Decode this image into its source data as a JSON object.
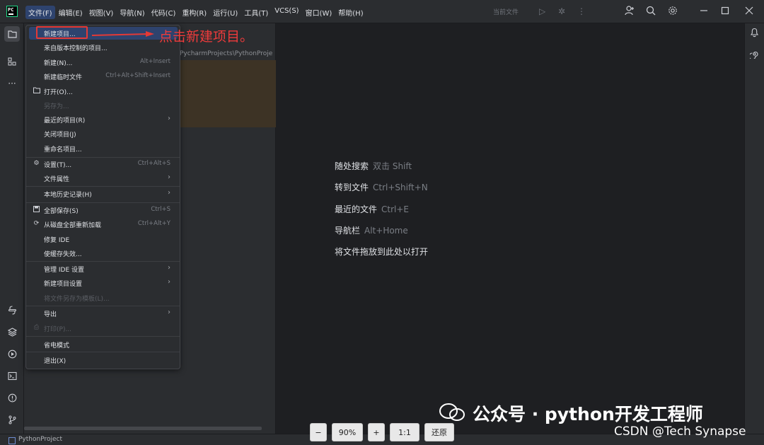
{
  "menubar": {
    "items": [
      "文件(F)",
      "编辑(E)",
      "视图(V)",
      "导航(N)",
      "代码(C)",
      "重构(R)",
      "运行(U)",
      "工具(T)",
      "VCS(S)",
      "窗口(W)",
      "帮助(H)"
    ],
    "current_file": "当前文件"
  },
  "project": {
    "path": "PycharmProjects\\PythonProje",
    "name": "PythonProject"
  },
  "file_menu": {
    "items": [
      {
        "label": "新建项目...",
        "shortcut": "",
        "icon": "",
        "arrow": false,
        "disabled": false
      },
      {
        "label": "来自版本控制的项目...",
        "shortcut": "",
        "icon": "",
        "arrow": false,
        "disabled": false
      },
      {
        "label": "新建(N)...",
        "shortcut": "Alt+Insert",
        "icon": "",
        "arrow": false,
        "disabled": false
      },
      {
        "label": "新建临时文件",
        "shortcut": "Ctrl+Alt+Shift+Insert",
        "icon": "",
        "arrow": false,
        "disabled": false
      },
      {
        "label": "打开(O)...",
        "shortcut": "",
        "icon": "folder-icon",
        "arrow": false,
        "disabled": false
      },
      {
        "label": "另存为...",
        "shortcut": "",
        "icon": "",
        "arrow": false,
        "disabled": true
      },
      {
        "label": "最近的项目(R)",
        "shortcut": "",
        "icon": "",
        "arrow": true,
        "disabled": false
      },
      {
        "label": "关闭项目(J)",
        "shortcut": "",
        "icon": "",
        "arrow": false,
        "disabled": false
      },
      {
        "label": "重命名项目...",
        "shortcut": "",
        "icon": "",
        "arrow": false,
        "disabled": false
      },
      {
        "label": "设置(T)...",
        "shortcut": "Ctrl+Alt+S",
        "icon": "gear-icon",
        "arrow": false,
        "disabled": false
      },
      {
        "label": "文件属性",
        "shortcut": "",
        "icon": "",
        "arrow": true,
        "disabled": false
      },
      {
        "label": "本地历史记录(H)",
        "shortcut": "",
        "icon": "",
        "arrow": true,
        "disabled": false
      },
      {
        "label": "全部保存(S)",
        "shortcut": "Ctrl+S",
        "icon": "save-icon",
        "arrow": false,
        "disabled": false
      },
      {
        "label": "从磁盘全部重新加载",
        "shortcut": "Ctrl+Alt+Y",
        "icon": "reload-icon",
        "arrow": false,
        "disabled": false
      },
      {
        "label": "修复 IDE",
        "shortcut": "",
        "icon": "",
        "arrow": false,
        "disabled": false
      },
      {
        "label": "使缓存失效...",
        "shortcut": "",
        "icon": "",
        "arrow": false,
        "disabled": false
      },
      {
        "label": "管理 IDE 设置",
        "shortcut": "",
        "icon": "",
        "arrow": true,
        "disabled": false
      },
      {
        "label": "新建项目设置",
        "shortcut": "",
        "icon": "",
        "arrow": true,
        "disabled": false
      },
      {
        "label": "将文件另存为模板(L)...",
        "shortcut": "",
        "icon": "",
        "arrow": false,
        "disabled": true
      },
      {
        "label": "导出",
        "shortcut": "",
        "icon": "",
        "arrow": true,
        "disabled": false
      },
      {
        "label": "打印(P)...",
        "shortcut": "",
        "icon": "print-icon",
        "arrow": false,
        "disabled": true
      },
      {
        "label": "省电模式",
        "shortcut": "",
        "icon": "",
        "arrow": false,
        "disabled": false
      },
      {
        "label": "退出(X)",
        "shortcut": "",
        "icon": "",
        "arrow": false,
        "disabled": false
      }
    ]
  },
  "annotation": "点击新建项目。",
  "welcome_hints": [
    {
      "label": "随处搜索",
      "key": "双击 Shift"
    },
    {
      "label": "转到文件",
      "key": "Ctrl+Shift+N"
    },
    {
      "label": "最近的文件",
      "key": "Ctrl+E"
    },
    {
      "label": "导航栏",
      "key": "Alt+Home"
    },
    {
      "label": "将文件拖放到此处以打开",
      "key": ""
    }
  ],
  "zoom_controls": {
    "minus": "−",
    "level": "90%",
    "plus": "+",
    "one_to_one": "1:1",
    "restore": "还原"
  },
  "watermark": {
    "wechat": "公众号 · python开发工程师",
    "csdn": "CSDN @Tech Synapse"
  },
  "colors": {
    "highlight": "#2e436e",
    "annotation": "#ef3b3b",
    "background": "#1e1f22",
    "panel": "#2b2d30"
  }
}
